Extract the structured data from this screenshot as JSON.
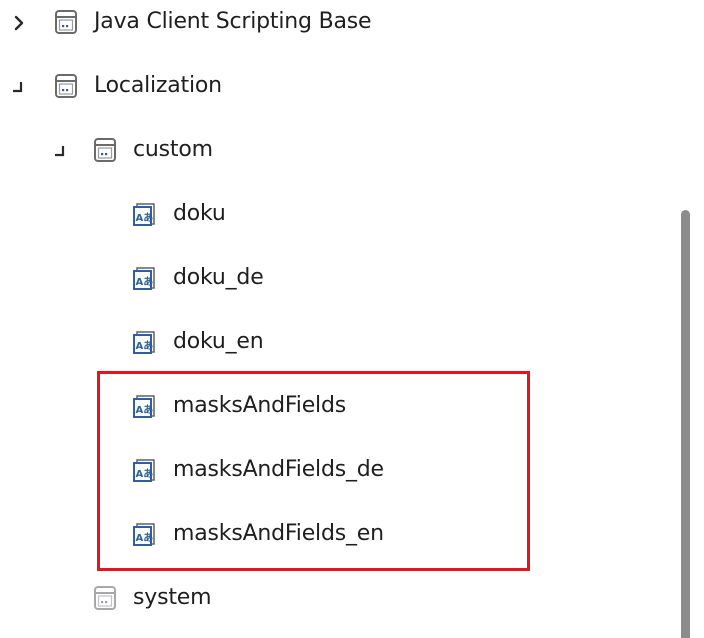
{
  "tree": {
    "items": [
      {
        "label": "Java Client Scripting Base",
        "icon": "folder-package-icon",
        "state": "collapsed"
      },
      {
        "label": "Localization",
        "icon": "folder-package-icon",
        "state": "expanded"
      },
      {
        "label": "custom",
        "icon": "folder-package-icon",
        "state": "expanded"
      },
      {
        "label": "doku",
        "icon": "localization-file-icon"
      },
      {
        "label": "doku_de",
        "icon": "localization-file-icon"
      },
      {
        "label": "doku_en",
        "icon": "localization-file-icon"
      },
      {
        "label": "masksAndFields",
        "icon": "localization-file-icon"
      },
      {
        "label": "masksAndFields_de",
        "icon": "localization-file-icon"
      },
      {
        "label": "masksAndFields_en",
        "icon": "localization-file-icon"
      },
      {
        "label": "system",
        "icon": "folder-package-icon-muted"
      }
    ]
  },
  "colors": {
    "highlight": "#e8141b",
    "icon_stroke": "#6a6a6a",
    "icon_blue": "#2f5f9e",
    "scrollbar": "#8c8c8c"
  }
}
